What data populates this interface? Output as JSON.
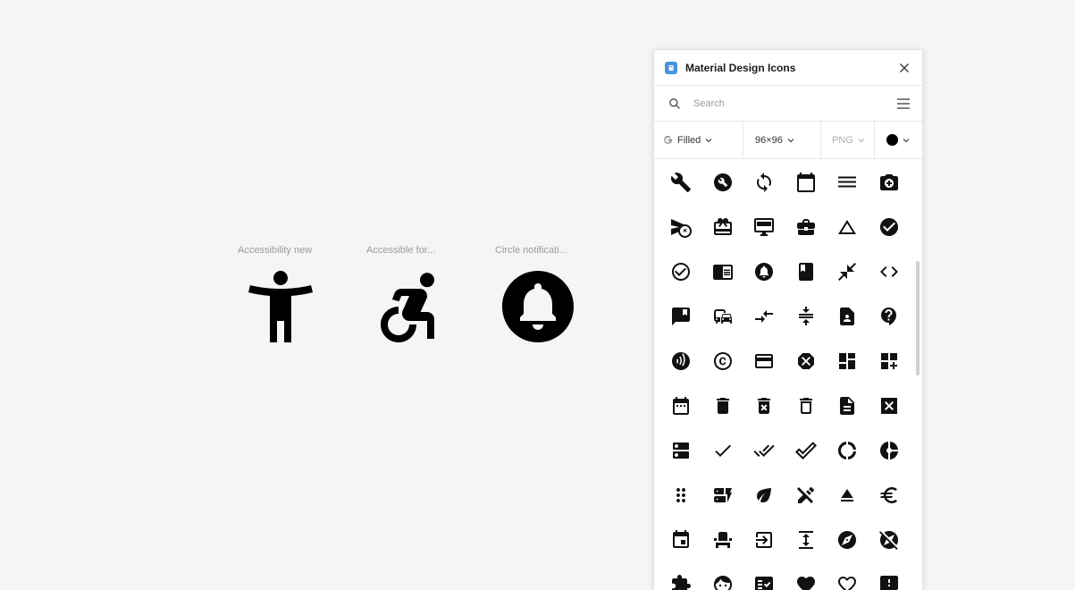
{
  "canvas": {
    "frames": [
      {
        "label": "Accessibility new",
        "icon": "accessibility-new-icon"
      },
      {
        "label": "Accessible for...",
        "icon": "accessible-forward-icon"
      },
      {
        "label": "Circle notificati...",
        "icon": "circle-notifications-icon"
      }
    ]
  },
  "panel": {
    "title": "Material Design Icons",
    "search_placeholder": "Search",
    "style_label": "Filled",
    "size_label": "96×96",
    "format_label": "PNG",
    "color": "#000000",
    "accent": "#4a90e2"
  },
  "grid_icons": [
    "build-icon",
    "build-circle-icon",
    "sync-icon",
    "calendar-today-icon",
    "dehaze-icon",
    "add-a-photo-icon",
    "cancel-schedule-send-icon",
    "redeem-icon",
    "desktop-windows-icon",
    "business-center-icon",
    "change-history-icon",
    "check-circle-icon",
    "check-circle-outline-icon",
    "chrome-reader-mode-icon",
    "circle-notifications-icon",
    "class-icon",
    "close-fullscreen-icon",
    "code-icon",
    "comment-bank-icon",
    "commute-icon",
    "compare-arrows-icon",
    "compress-icon",
    "contact-page-icon",
    "contact-support-icon",
    "contactless-icon",
    "copyright-icon",
    "credit-card-icon",
    "dangerous-icon",
    "dashboard-icon",
    "dashboard-customize-icon",
    "date-range-icon",
    "delete-icon",
    "delete-forever-icon",
    "delete-outline-icon",
    "description-icon",
    "disabled-by-default-icon",
    "dns-icon",
    "done-icon",
    "done-all-icon",
    "done-outline-icon",
    "donut-large-icon",
    "donut-small-icon",
    "drag-indicator-icon",
    "dynamic-form-icon",
    "eco-icon",
    "edit-off-icon",
    "eject-icon",
    "euro-symbol-icon",
    "event-icon",
    "event-seat-icon",
    "exit-to-app-icon",
    "expand-icon",
    "explore-icon",
    "explore-off-icon",
    "extension-icon",
    "face-icon",
    "fact-check-icon",
    "favorite-icon",
    "favorite-border-icon",
    "feedback-icon"
  ]
}
